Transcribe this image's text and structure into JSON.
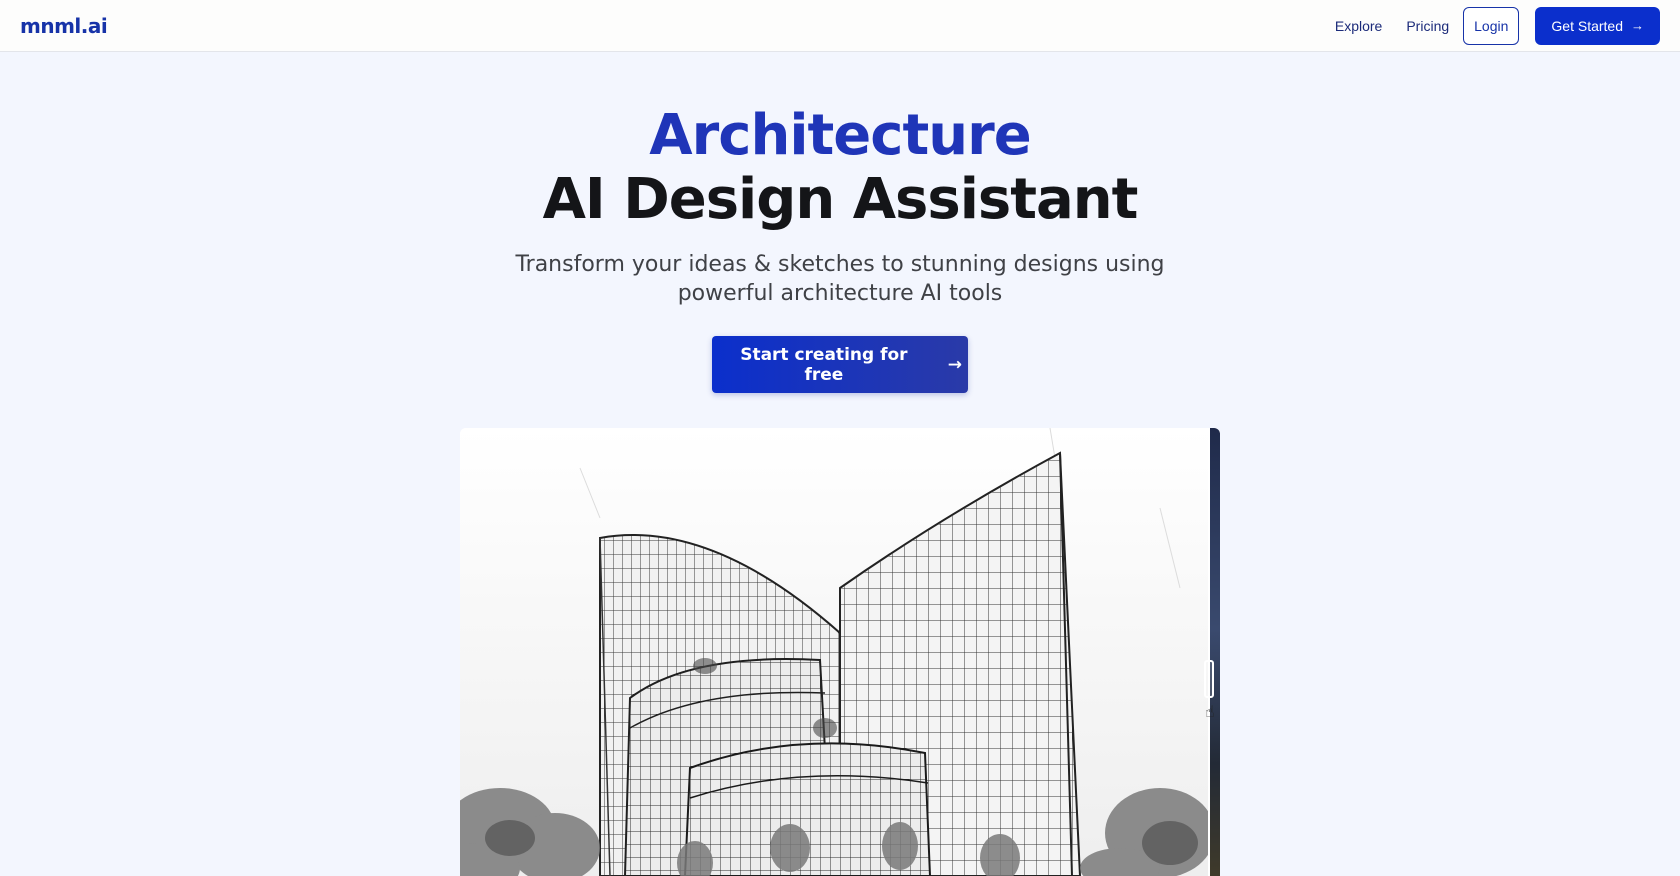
{
  "header": {
    "logo": "mnml.ai",
    "nav": {
      "explore": "Explore",
      "pricing": "Pricing",
      "login": "Login",
      "get_started": "Get Started",
      "get_started_icon": "arrow-right-icon"
    }
  },
  "hero": {
    "headline_accent": "Architecture",
    "headline_main": "AI Design Assistant",
    "subtitle": "Transform your ideas & sketches to stunning designs using powerful architecture AI tools",
    "cta_label": "Start creating for free",
    "cta_icon": "arrow-right-icon"
  },
  "comparison": {
    "before_image": "architecture-sketch",
    "after_image": "rendered-photo",
    "handle_icon": "slider-handle-icon",
    "cursor_icon": "hand-pointer-icon"
  },
  "colors": {
    "brand": "#0b2fcc",
    "accent_heading": "#1f35b8",
    "background": "#f3f6fe",
    "text_dark": "#141518"
  }
}
